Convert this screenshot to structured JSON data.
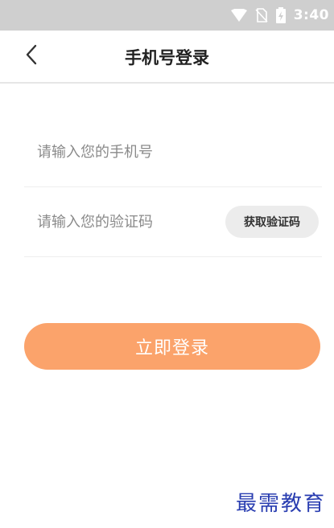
{
  "status_bar": {
    "time": "3:40",
    "icons": [
      "wifi-icon",
      "no-sim-icon",
      "battery-charging-icon"
    ]
  },
  "app_bar": {
    "back_icon": "chevron-left-icon",
    "title": "手机号登录"
  },
  "form": {
    "phone": {
      "value": "",
      "placeholder": "请输入您的手机号"
    },
    "code": {
      "value": "",
      "placeholder": "请输入您的验证码"
    },
    "get_code_label": "获取验证码"
  },
  "login_label": "立即登录",
  "watermark": "最需教育",
  "colors": {
    "status_bar": "#cfcfcf",
    "accent": "#fba36b",
    "code_button_bg": "#ececec",
    "watermark": "#2a3eb1"
  }
}
